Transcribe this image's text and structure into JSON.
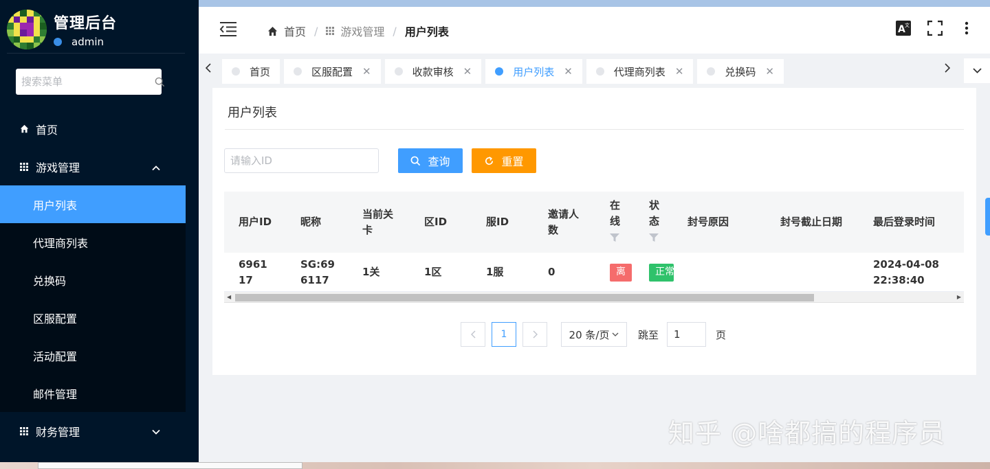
{
  "app": {
    "title": "管理后台",
    "username": "admin"
  },
  "sidebar": {
    "search_placeholder": "搜索菜单",
    "menu": {
      "home": "首页",
      "game_mgmt": "游戏管理",
      "game_sub": [
        "用户列表",
        "代理商列表",
        "兑换码",
        "区服配置",
        "活动配置",
        "邮件管理"
      ],
      "finance": "财务管理"
    }
  },
  "breadcrumb": [
    "首页",
    "游戏管理",
    "用户列表"
  ],
  "header_icons": [
    "translate-icon",
    "fullscreen-icon",
    "more-vertical-icon"
  ],
  "tabs": [
    {
      "label": "首页",
      "closable": false,
      "active": false
    },
    {
      "label": "区服配置",
      "closable": true,
      "active": false
    },
    {
      "label": "收款审核",
      "closable": true,
      "active": false
    },
    {
      "label": "用户列表",
      "closable": true,
      "active": true
    },
    {
      "label": "代理商列表",
      "closable": true,
      "active": false
    },
    {
      "label": "兑换码",
      "closable": true,
      "active": false
    }
  ],
  "page": {
    "title": "用户列表",
    "id_placeholder": "请输入ID",
    "query_btn": "查询",
    "reset_btn": "重置"
  },
  "table": {
    "headers": {
      "uid": "用户ID",
      "nick": "昵称",
      "level": "当前关卡",
      "zone": "区ID",
      "server": "服ID",
      "invites": "邀请人数",
      "online": "在线",
      "status": "状态",
      "ban_reason": "封号原因",
      "ban_until": "封号截止日期",
      "last_login": "最后登录时间"
    },
    "rows": [
      {
        "uid": "696117",
        "nick": "SG:696117",
        "level": "1关",
        "zone": "1区",
        "server": "1服",
        "invites": "0",
        "online": "离",
        "status": "正常",
        "ban_reason": "",
        "ban_until": "",
        "last_login": "2024-04-08 22:38:40"
      }
    ]
  },
  "pagination": {
    "current": "1",
    "page_size": "20 条/页",
    "jump_label": "跳至",
    "jump_value": "1",
    "jump_unit": "页"
  },
  "watermark": "知乎 @啥都搞的程序员",
  "colors": {
    "sidebar_bg": "#001529",
    "primary": "#409eff",
    "reset": "#ff9800",
    "danger": "#f56c6c",
    "success": "#2fc26b"
  }
}
